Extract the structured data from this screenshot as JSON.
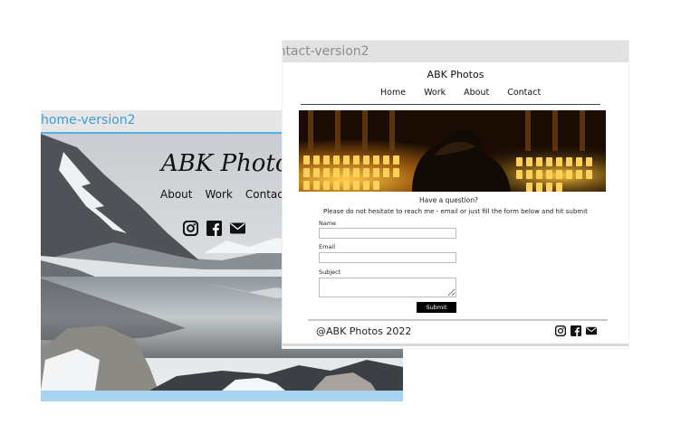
{
  "home_window": {
    "title": "home-version2",
    "site_title": "ABK Photos",
    "nav": [
      "About",
      "Work",
      "Contact"
    ],
    "social_icons": [
      "instagram-icon",
      "facebook-icon",
      "mail-icon"
    ]
  },
  "contact_window": {
    "title": "ontact-version2",
    "site_title": "ABK Photos",
    "nav": [
      "Home",
      "Work",
      "About",
      "Contact"
    ],
    "question": "Have a question?",
    "description": "Please do not hesitate to reach me - email or just fill the form below and hit submit",
    "form": {
      "name_label": "Name",
      "email_label": "Email",
      "subject_label": "Subject",
      "submit_label": "Submit"
    },
    "footer_text": "@ABK Photos 2022",
    "footer_social_icons": [
      "instagram-icon",
      "facebook-icon",
      "mail-icon"
    ]
  },
  "colors": {
    "accent_blue": "#3d9be0",
    "title_bar": "#e2e2e2"
  }
}
